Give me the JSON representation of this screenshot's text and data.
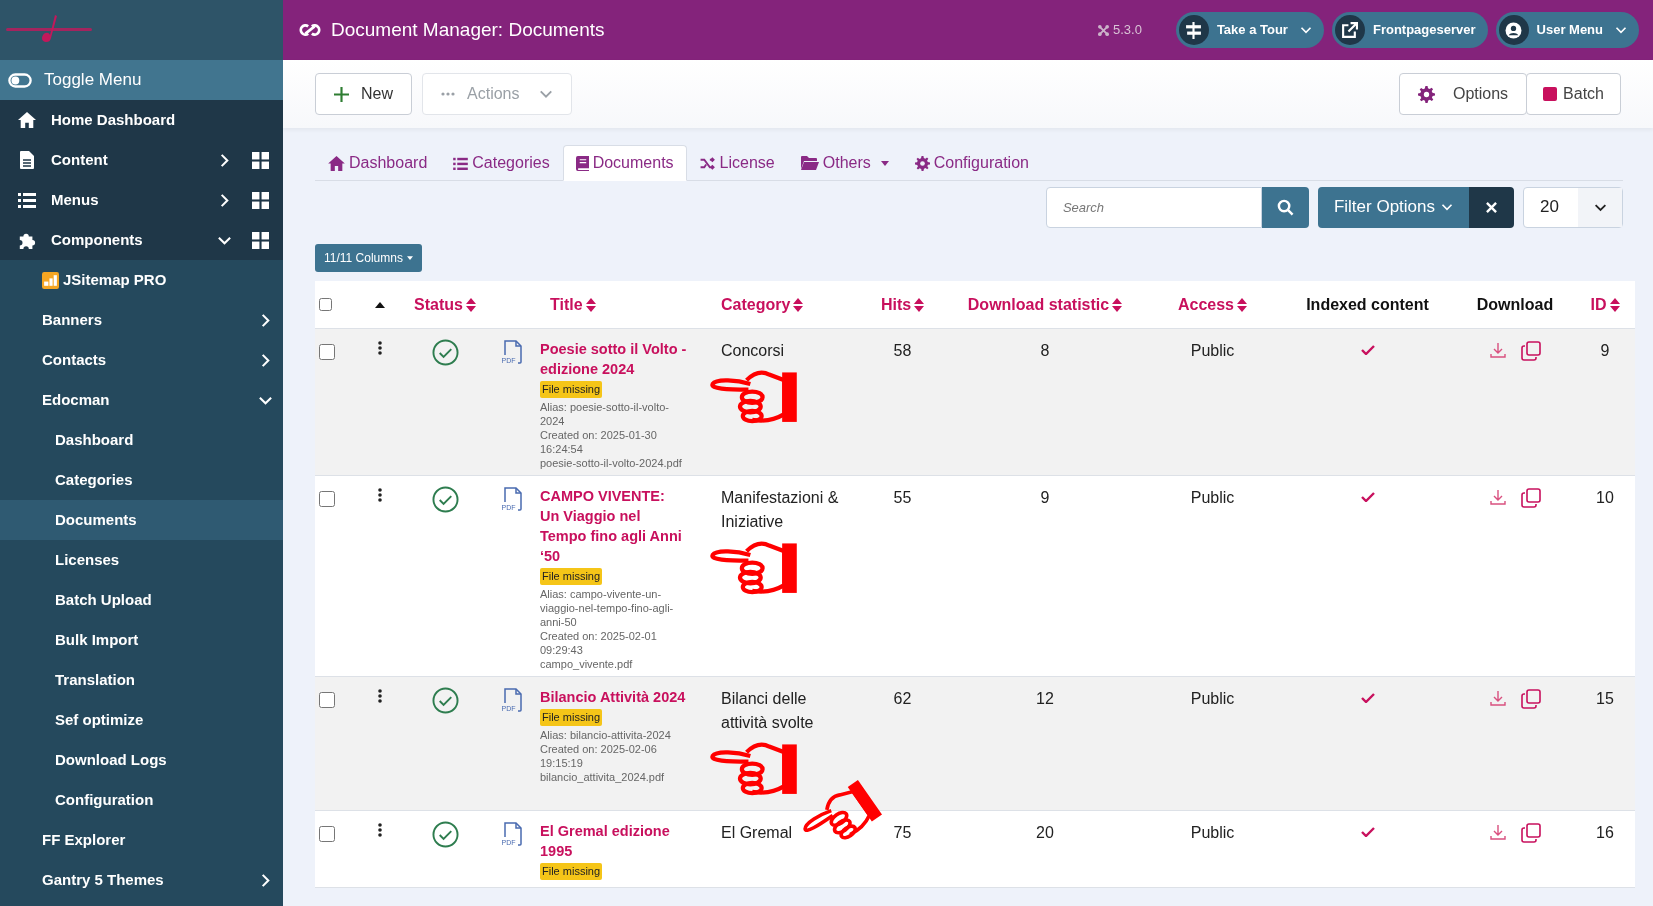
{
  "header": {
    "title": "Document Manager: Documents",
    "version": "5.3.0",
    "buttons": [
      {
        "label": "Take a Tour",
        "dropdown": true
      },
      {
        "label": "Frontpageserver",
        "dropdown": false
      },
      {
        "label": "User Menu",
        "dropdown": true
      }
    ]
  },
  "sidebar": {
    "toggle_menu": {
      "label": "Toggle Menu"
    },
    "items": [
      {
        "label": "Home Dashboard",
        "selected": false
      },
      {
        "label": "Content",
        "selected": false,
        "expanded": false,
        "grid": true
      },
      {
        "label": "Menus",
        "selected": false,
        "expanded": false,
        "grid": true
      },
      {
        "label": "Components",
        "selected": false,
        "expanded": true,
        "grid": true,
        "children": [
          {
            "label": "JSitemap PRO",
            "selected": false
          },
          {
            "label": "Banners",
            "selected": false,
            "expanded": false
          },
          {
            "label": "Contacts",
            "selected": false,
            "expanded": false
          },
          {
            "label": "Edocman",
            "selected": false,
            "expanded": true,
            "children": [
              {
                "label": "Dashboard",
                "selected": false
              },
              {
                "label": "Categories",
                "selected": false
              },
              {
                "label": "Documents",
                "selected": true
              },
              {
                "label": "Licenses",
                "selected": false
              },
              {
                "label": "Batch Upload",
                "selected": false
              },
              {
                "label": "Bulk Import",
                "selected": false
              },
              {
                "label": "Translation",
                "selected": false
              },
              {
                "label": "Sef optimize",
                "selected": false
              },
              {
                "label": "Download Logs",
                "selected": false
              },
              {
                "label": "Configuration",
                "selected": false
              }
            ]
          },
          {
            "label": "FF Explorer",
            "selected": false
          },
          {
            "label": "Gantry 5 Themes",
            "selected": false,
            "expanded": false
          }
        ]
      }
    ]
  },
  "toolbar": {
    "left": [
      {
        "label": "New",
        "disabled": false
      },
      {
        "label": "Actions",
        "disabled": true
      }
    ],
    "right": [
      {
        "label": "Options"
      },
      {
        "label": "Batch"
      }
    ]
  },
  "tabs": [
    {
      "label": "Dashboard",
      "selected": false
    },
    {
      "label": "Categories",
      "selected": false
    },
    {
      "label": "Documents",
      "selected": true
    },
    {
      "label": "License",
      "selected": false
    },
    {
      "label": "Others",
      "selected": false,
      "dropdown": true
    },
    {
      "label": "Configuration",
      "selected": false
    }
  ],
  "filters": {
    "search": {
      "placeholder": "Search"
    },
    "filter_button": "Filter Options",
    "limit": "20",
    "columns_button": "11/11 Columns"
  },
  "table": {
    "select_all": false,
    "columns": [
      {
        "label": "Status",
        "sortable": true
      },
      {
        "label": "Title",
        "sortable": true
      },
      {
        "label": "Category",
        "sortable": true
      },
      {
        "label": "Hits",
        "sortable": true
      },
      {
        "label": "Download statistic",
        "sortable": true
      },
      {
        "label": "Access",
        "sortable": true
      },
      {
        "label": "Indexed content",
        "sortable": false
      },
      {
        "label": "Download",
        "sortable": false
      },
      {
        "label": "ID",
        "sortable": true
      }
    ],
    "rows": [
      {
        "checked": false,
        "published": true,
        "title": "Poesie sotto il Volto - edizione 2024",
        "badge": "File missing",
        "alias": "Alias: poesie-sotto-il-volto-2024",
        "created": "Created on: 2025-01-30 16:24:54",
        "filename": "poesie-sotto-il-volto-2024.pdf",
        "category": "Concorsi",
        "hits": "58",
        "downloads": "8",
        "access": "Public",
        "indexed": true,
        "id": "9",
        "file_type": "PDF",
        "pointer": {
          "kind": "left"
        }
      },
      {
        "checked": false,
        "published": true,
        "title": "CAMPO VIVENTE: Un Viaggio nel Tempo fino agli Anni ‘50",
        "badge": "File missing",
        "alias": "Alias: campo-vivente-un-viaggio-nel-tempo-fino-agli-anni-50",
        "created": "Created on: 2025-02-01 09:29:43",
        "filename": "campo_vivente.pdf",
        "category": "Manifestazioni & Iniziative",
        "hits": "55",
        "downloads": "9",
        "access": "Public",
        "indexed": true,
        "id": "10",
        "file_type": "PDF",
        "pointer": {
          "kind": "left"
        }
      },
      {
        "checked": false,
        "published": true,
        "title": "Bilancio Attività 2024",
        "badge": "File missing",
        "alias": "Alias: bilancio-attivita-2024",
        "created": "Created on: 2025-02-06 19:15:19",
        "filename": "bilancio_attivita_2024.pdf",
        "category": "Bilanci delle attività svolte",
        "hits": "62",
        "downloads": "12",
        "access": "Public",
        "indexed": true,
        "id": "15",
        "file_type": "PDF",
        "pointer": {
          "kind": "left"
        }
      },
      {
        "checked": false,
        "published": true,
        "title": "El Gremal edizione 1995",
        "badge": "File missing",
        "category": "El Gremal",
        "hits": "75",
        "downloads": "20",
        "access": "Public",
        "indexed": true,
        "id": "16",
        "file_type": "PDF",
        "pointer": {
          "kind": "down-left"
        }
      }
    ]
  }
}
